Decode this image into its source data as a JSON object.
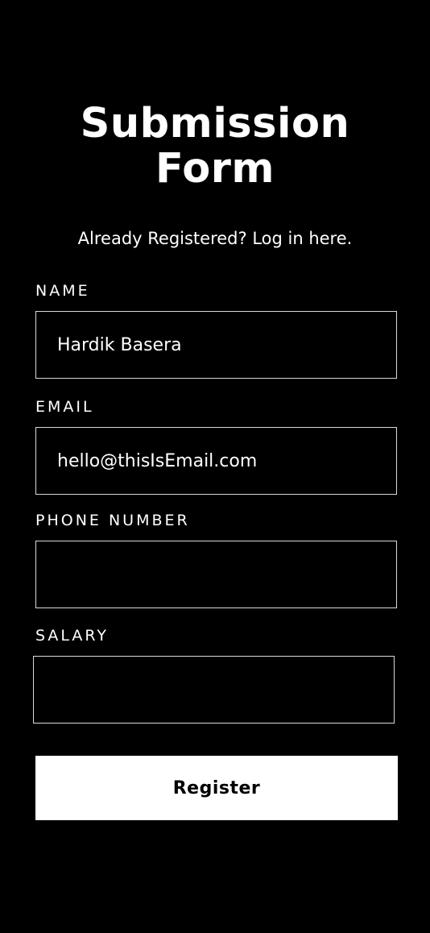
{
  "form": {
    "title_line1": "Submission",
    "title_line2": "Form",
    "login_link": "Already Registered? Log in here.",
    "fields": {
      "name": {
        "label": "NAME",
        "value": "Hardik Basera"
      },
      "email": {
        "label": "EMAIL",
        "value": "hello@thisIsEmail.com"
      },
      "phone": {
        "label": "PHONE NUMBER",
        "value": ""
      },
      "salary": {
        "label": "SALARY",
        "value": ""
      }
    },
    "register_label": "Register"
  },
  "colors": {
    "background": "#000000",
    "foreground": "#ffffff",
    "input_border": "#d9d9d9",
    "button_text": "#000000"
  }
}
